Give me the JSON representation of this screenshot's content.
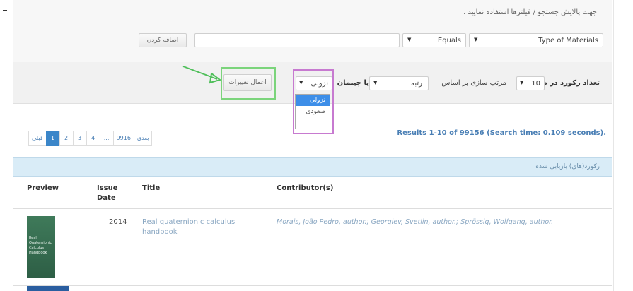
{
  "filter": {
    "hint": "جهت پالایش جستجو / فیلترها استفاده نمایید .",
    "field_select": "Type of Materials",
    "operator_select": "Equals",
    "value_input": "",
    "add_button": "اضافه کردن"
  },
  "sort": {
    "rpp_label": "تعداد رکورد در صفحه",
    "rpp_value": "10",
    "sort_by_label": "مرتب سازی بر اساس",
    "sort_by_value": "رتبه",
    "order_label": "یا چینمان",
    "order_value": "نزولی",
    "order_options": [
      "نزولی",
      "صعودی"
    ],
    "apply_button": "اعمال تغییرات"
  },
  "pagination": {
    "prev": "قبلی",
    "pages": [
      "1",
      "2",
      "3",
      "4",
      "...",
      "9916"
    ],
    "next": "بعدی",
    "active_page": "1"
  },
  "results": {
    "summary": "Results 1-10 of 99156 (Search time: 0.109 seconds).",
    "bar_title": "رکورد(های) بازیابی شده"
  },
  "table": {
    "headers": {
      "preview": "Preview",
      "issue_date": "Issue Date",
      "title": "Title",
      "contributors": "Contributor(s)"
    },
    "rows": [
      {
        "issue_date": "2014",
        "title": "Real quaternionic calculus handbook",
        "contributors": "Morais, João Pedro, author.; Georgiev, Svetlin, author.; Sprössig, Wolfgang, author.",
        "cover_text": "Real Quaternionic Calculus Handbook"
      }
    ]
  },
  "colors": {
    "accent_blue": "#3b86c9",
    "green_highlight": "#7bd47b",
    "purple_highlight": "#c77ad0",
    "results_bar": "#d9ecf7"
  }
}
